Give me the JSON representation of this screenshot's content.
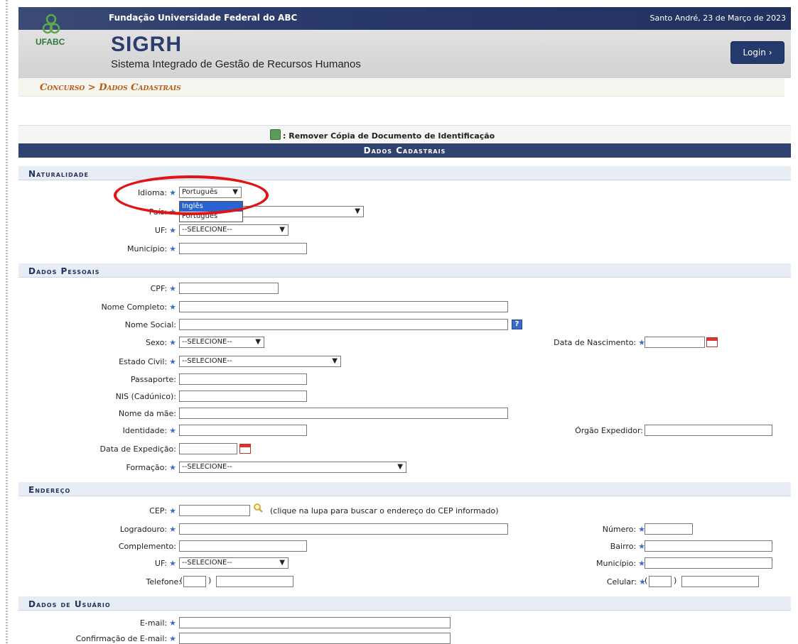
{
  "header": {
    "institution": "Fundação Universidade Federal do ABC",
    "date": "Santo André, 23 de Março de 2023",
    "logo_text": "UFABC",
    "app_name": "SIGRH",
    "app_subtitle": "Sistema Integrado de Gestão de Recursos Humanos",
    "login_label": "Login ›"
  },
  "breadcrumb": "Concurso > Dados Cadastrais",
  "action_bar": {
    "label": ": Remover Cópia de Documento de Identificação",
    "icon": "document-remove-icon"
  },
  "caption": "Dados Cadastrais",
  "sections": {
    "naturalidade": "Naturalidade",
    "dados_pessoais": "Dados Pessoais",
    "endereco": "Endereço",
    "dados_usuario": "Dados de Usuário"
  },
  "naturalidade": {
    "idioma_label": "Idioma:",
    "idioma_value": "Português",
    "idioma_options": [
      "Inglês",
      "Português"
    ],
    "pais_label": "País:",
    "uf_label": "UF:",
    "uf_value": "--SELECIONE--",
    "municipio_label": "Município:"
  },
  "pessoais": {
    "cpf": "CPF:",
    "nome_completo": "Nome Completo:",
    "nome_social": "Nome Social:",
    "sexo": "Sexo:",
    "sexo_value": "--SELECIONE--",
    "data_nascimento": "Data de Nascimento:",
    "estado_civil": "Estado Civil:",
    "estado_civil_value": "--SELECIONE--",
    "passaporte": "Passaporte:",
    "nis": "NIS (Cadúnico):",
    "nome_mae": "Nome da mãe:",
    "identidade": "Identidade:",
    "orgao": "Órgão Expedidor:",
    "data_expedicao": "Data de Expedição:",
    "formacao": "Formação:",
    "formacao_value": "--SELECIONE--"
  },
  "endereco": {
    "cep": "CEP:",
    "cep_note": "(clique na lupa para buscar o endereço do CEP informado)",
    "logradouro": "Logradouro:",
    "numero": "Número:",
    "complemento": "Complemento:",
    "bairro": "Bairro:",
    "uf": "UF:",
    "uf_value": "--SELECIONE--",
    "municipio": "Município:",
    "telefone": "Telefone:",
    "celular": "Celular:"
  },
  "usuario": {
    "email": "E-mail:",
    "confirmacao": "Confirmação de E-mail:"
  },
  "colors": {
    "header_blue": "#2f4270",
    "accent_orange": "#b85a14",
    "required_star": "#3a6fc4",
    "highlight_red": "#e01414"
  }
}
